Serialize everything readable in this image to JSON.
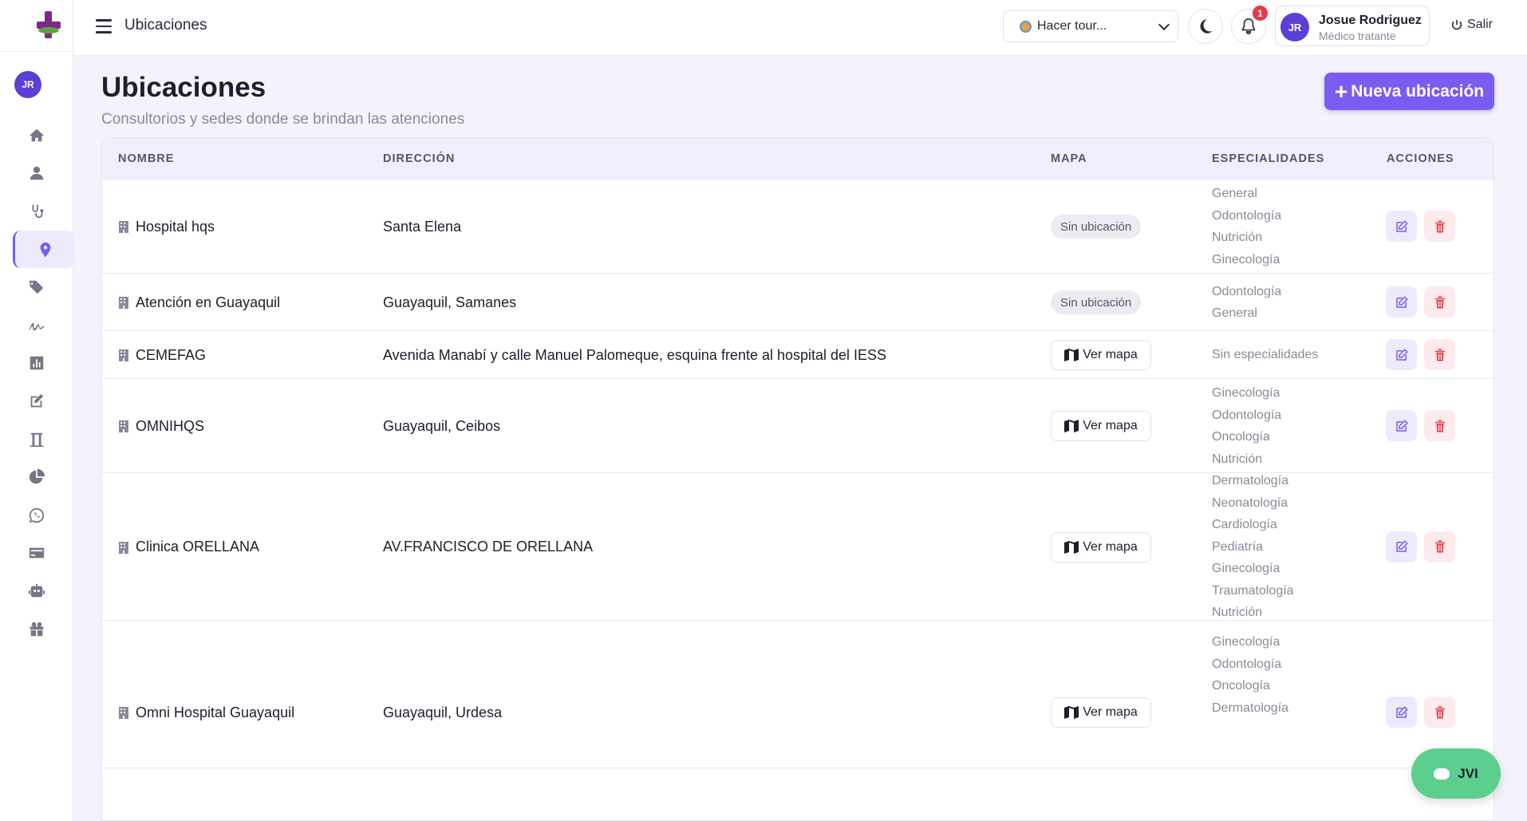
{
  "sidebar": {
    "avatar_initials": "JR",
    "items": [
      {
        "icon": "home-icon"
      },
      {
        "icon": "user-icon"
      },
      {
        "icon": "stethoscope-icon"
      },
      {
        "icon": "map-pin-icon",
        "active": true
      },
      {
        "icon": "tags-icon"
      },
      {
        "icon": "signature-icon"
      },
      {
        "icon": "chart-bar-icon"
      },
      {
        "icon": "edit-icon"
      },
      {
        "icon": "flask-icon"
      },
      {
        "icon": "pie-chart-icon"
      },
      {
        "icon": "whatsapp-icon"
      },
      {
        "icon": "credit-card-icon"
      },
      {
        "icon": "robot-icon"
      },
      {
        "icon": "gift-icon"
      }
    ]
  },
  "topbar": {
    "title": "Ubicaciones",
    "tour_label": "Hacer tour...",
    "notifications_count": "1",
    "user": {
      "initials": "JR",
      "name": "Josue Rodriguez",
      "role": "Médico tratante"
    },
    "logout_label": "Salir"
  },
  "page": {
    "title": "Ubicaciones",
    "subtitle": "Consultorios y sedes donde se brindan las atenciones",
    "new_button_label": "Nueva ubicación"
  },
  "table": {
    "headers": {
      "name": "NOMBRE",
      "address": "DIRECCIÓN",
      "map": "MAPA",
      "specialties": "ESPECIALIDADES",
      "actions": "ACCIONES"
    },
    "rows": [
      {
        "name": "Hospital hqs",
        "address": "Santa Elena",
        "map": "Sin ubicación",
        "map_type": "none",
        "specialties": [
          "General",
          "Odontología",
          "Nutrición",
          "Ginecología"
        ]
      },
      {
        "name": "Atención en Guayaquil",
        "address": "Guayaquil, Samanes",
        "map": "Sin ubicación",
        "map_type": "none",
        "specialties": [
          "Odontología",
          "General"
        ]
      },
      {
        "name": "CEMEFAG",
        "address": "Avenida Manabí y calle Manuel Palomeque, esquina frente al hospital del IESS",
        "map": "Ver mapa",
        "map_type": "link",
        "specialties": [
          "Sin especialidades"
        ]
      },
      {
        "name": "OMNIHQS",
        "address": "Guayaquil, Ceibos",
        "map": "Ver mapa",
        "map_type": "link",
        "specialties": [
          "Ginecología",
          "Odontología",
          "Oncología",
          "Nutrición"
        ]
      },
      {
        "name": "Clinica ORELLANA",
        "address": "AV.FRANCISCO DE ORELLANA",
        "map": "Ver mapa",
        "map_type": "link",
        "specialties": [
          "Dermatología",
          "Neonatología",
          "Cardiología",
          "Pediatría",
          "Ginecología",
          "Traumatología",
          "Nutrición"
        ]
      },
      {
        "name": "Omni Hospital Guayaquil",
        "address": "Guayaquil, Urdesa",
        "map": "Ver mapa",
        "map_type": "link",
        "specialties": [
          "Ginecología",
          "Odontología",
          "Oncología",
          "Dermatología"
        ]
      }
    ]
  },
  "chat": {
    "label": "JVI"
  },
  "colors": {
    "accent": "#7b5cf0",
    "danger": "#e53946",
    "chat": "#5ccf8e",
    "avatar": "#5b3fd6"
  }
}
